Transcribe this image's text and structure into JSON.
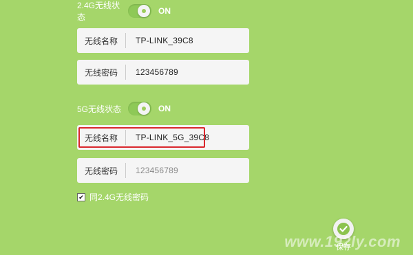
{
  "wifi_24g": {
    "status_label": "2.4G无线状态",
    "toggle_state": "ON",
    "name_label": "无线名称",
    "name_value": "TP-LINK_39C8",
    "password_label": "无线密码",
    "password_value": "123456789"
  },
  "wifi_5g": {
    "status_label": "5G无线状态",
    "toggle_state": "ON",
    "name_label": "无线名称",
    "name_value": "TP-LINK_5G_39C8",
    "password_label": "无线密码",
    "password_value": "123456789"
  },
  "same_password_checkbox": {
    "label": "同2.4G无线密码",
    "checked": true,
    "check_glyph": "✔"
  },
  "save_button": {
    "label": "保存",
    "icon": "check-icon"
  },
  "watermark": {
    "text": "www.192ly.com"
  },
  "colors": {
    "background": "#a5d66a",
    "field_bg": "#f5f5f5",
    "highlight_border": "#d9262c"
  }
}
